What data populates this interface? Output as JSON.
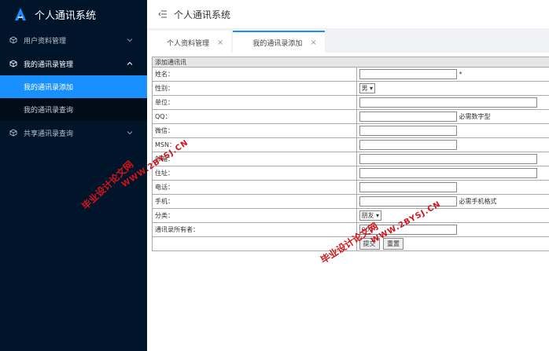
{
  "app": {
    "title": "个人通讯系统"
  },
  "sidebar": {
    "groups": [
      {
        "label": "用户资料管理"
      },
      {
        "label": "我的通讯录管理",
        "items": [
          {
            "label": "我的通讯录添加"
          },
          {
            "label": "我的通讯录查询"
          }
        ]
      },
      {
        "label": "共享通讯录查询"
      }
    ]
  },
  "header": {
    "title": "个人通讯系统"
  },
  "tabs": [
    {
      "label": "个人资料管理",
      "close": "×"
    },
    {
      "label": "我的通讯录添加",
      "close": "×"
    }
  ],
  "form": {
    "caption": "添加通讯讯",
    "required_mark": "*",
    "fields": {
      "name": "姓名：",
      "gender": "性别：",
      "unit": "单位：",
      "qq": "QQ：",
      "weixin": "微信：",
      "msn": "MSN：",
      "email": "邮箱：",
      "address": "住址：",
      "phone": "电话：",
      "mobile": "手机：",
      "category": "分类：",
      "owner": "通讯录所有者："
    },
    "gender_value": "男",
    "category_value": "朋友",
    "owner_value": "001",
    "hint_numeric": "必需数字型",
    "hint_mobile": "必需手机格式",
    "submit": "提交",
    "reset": "重置"
  },
  "watermarks": {
    "cn": "毕业设计论文网",
    "url": "WWW.2BYSJ.CN"
  }
}
